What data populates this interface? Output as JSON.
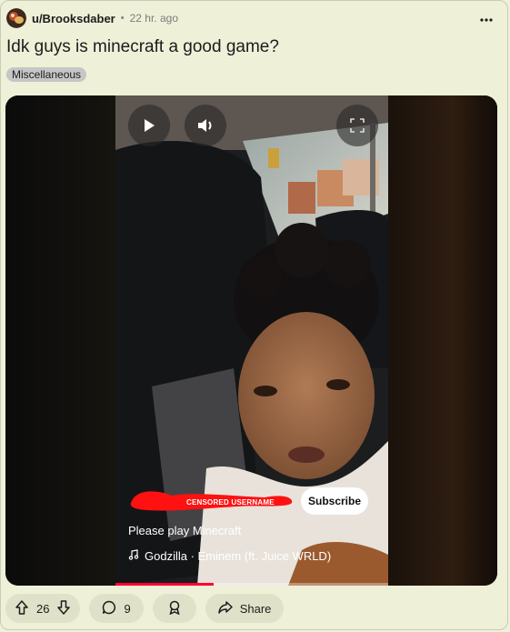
{
  "post": {
    "author": "u/Brooksdaber",
    "separator": "•",
    "time": "22 hr. ago",
    "title": "Idk guys is minecraft a good game?",
    "flair": "Miscellaneous"
  },
  "video": {
    "censor_label": "CENSORED USERNAME",
    "subscribe_label": "Subscribe",
    "caption": "Please play Minecraft",
    "song": "Godzilla · Eminem (ft. Juice WRLD)",
    "progress": 0.36
  },
  "actions": {
    "upvotes": "26",
    "comments": "9",
    "share_label": "Share"
  },
  "colors": {
    "background": "#eef0d8",
    "pill": "#dfe2c8",
    "progress": "#ff0033"
  },
  "icons": [
    "avatar",
    "more-dots-icon",
    "play-icon",
    "volume-icon",
    "fullscreen-icon",
    "music-note-icon",
    "upvote-icon",
    "downvote-icon",
    "comment-icon",
    "award-icon",
    "share-icon"
  ]
}
